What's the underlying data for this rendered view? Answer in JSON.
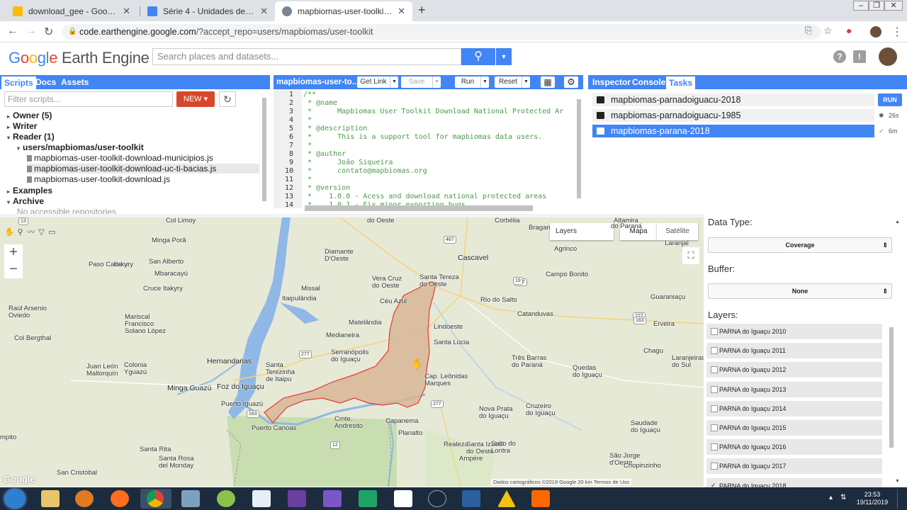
{
  "browser": {
    "tabs": [
      {
        "title": "download_gee - Google Drive",
        "color": "#fbbc05"
      },
      {
        "title": "Série 4 - Unidades de Conservaç",
        "color": "#4285f4"
      },
      {
        "title": "mapbiomas-user-toolkit-downlo",
        "color": "#7a8594"
      }
    ],
    "url_host": "code.earthengine.google.com",
    "url_path": "/?accept_repo=users/mapbiomas/user-toolkit"
  },
  "header": {
    "logo_google": [
      "G",
      "o",
      "o",
      "g",
      "l",
      "e"
    ],
    "logo_rest": "Earth Engine",
    "search_placeholder": "Search places and datasets..."
  },
  "left_panel": {
    "tabs": [
      "Scripts",
      "Docs",
      "Assets"
    ],
    "filter_placeholder": "Filter scripts...",
    "new_label": "NEW",
    "tree": [
      {
        "label": "Owner  (5)",
        "arrow": "▸",
        "bold": true,
        "indent": 0
      },
      {
        "label": "Writer",
        "arrow": "▸",
        "bold": true,
        "indent": 0
      },
      {
        "label": "Reader  (1)",
        "arrow": "▾",
        "bold": true,
        "indent": 0
      },
      {
        "label": "users/mapbiomas/user-toolkit",
        "arrow": "▾",
        "bold": true,
        "indent": 1
      },
      {
        "label": "mapbiomas-user-toolkit-download-municipios.js",
        "file": true,
        "indent": 2
      },
      {
        "label": "mapbiomas-user-toolkit-download-uc-ti-bacias.js",
        "file": true,
        "indent": 2,
        "highlight": true
      },
      {
        "label": "mapbiomas-user-toolkit-download.js",
        "file": true,
        "indent": 2
      },
      {
        "label": "Examples",
        "arrow": "▸",
        "bold": true,
        "indent": 0
      },
      {
        "label": "Archive",
        "arrow": "▾",
        "bold": true,
        "indent": 0
      },
      {
        "label": "No accessible repositories",
        "indent": 1,
        "muted": true
      }
    ]
  },
  "code_panel": {
    "title": "mapbiomas-user-to...",
    "buttons": [
      "Get Link",
      "Save",
      "Run",
      "Reset"
    ],
    "lines": [
      {
        "n": "1",
        "t": "/**"
      },
      {
        "n": "2",
        "t": " * @name"
      },
      {
        "n": "3",
        "t": " *      Mapbiomas User Toolkit Download National Protected Ar"
      },
      {
        "n": "4",
        "t": " *"
      },
      {
        "n": "5",
        "t": " * @description"
      },
      {
        "n": "6",
        "t": " *      This is a support tool for mapbiomas data users."
      },
      {
        "n": "7",
        "t": " *"
      },
      {
        "n": "8",
        "t": " * @author"
      },
      {
        "n": "9",
        "t": " *      João Siqueira"
      },
      {
        "n": "10",
        "t": " *      contato@mapbiomas.org"
      },
      {
        "n": "11",
        "t": " *"
      },
      {
        "n": "12",
        "t": " * @version"
      },
      {
        "n": "13",
        "t": " *    1.0.0 - Acess and download national protected areas"
      },
      {
        "n": "14",
        "t": " *    1.0.1 - Fix minor exporting bugs"
      }
    ]
  },
  "task_panel": {
    "tabs": [
      "Inspector",
      "Console",
      "Tasks"
    ],
    "tasks": [
      {
        "name": "mapbiomas-parnadoiguacu-2018",
        "status": "RUN"
      },
      {
        "name": "mapbiomas-parnadoiguacu-1985",
        "status": "26s"
      },
      {
        "name": "mapbiomas-parana-2018",
        "status": "6m"
      }
    ]
  },
  "map": {
    "layers_label": "Layers",
    "map_types": [
      "Mapa",
      "Satélite"
    ],
    "places": [
      {
        "t": "Col Limoy",
        "c": "mid"
      },
      {
        "t": "do Oeste",
        "c": "mid"
      },
      {
        "t": "Corbélia",
        "c": "mid"
      },
      {
        "t": "Bragan",
        "c": "mid"
      },
      {
        "t": "Altamira",
        "c": "mid"
      },
      {
        "t": "do Paraná",
        "c": "mid"
      },
      {
        "t": "Minga Porã",
        "c": "mid"
      },
      {
        "t": "Diamante\nD'Oeste",
        "c": "mid"
      },
      {
        "t": "Cascavel",
        "c": "big"
      },
      {
        "t": "Agrinco",
        "c": "mid"
      },
      {
        "t": "Laranjal",
        "c": "mid"
      },
      {
        "t": "Paso Cadena",
        "c": "mid"
      },
      {
        "t": "Itakyry",
        "c": "mid"
      },
      {
        "t": "San Alberto",
        "c": "mid"
      },
      {
        "t": "Mbaracayú",
        "c": "mid"
      },
      {
        "t": "Vera Cruz\ndo Oeste",
        "c": "mid"
      },
      {
        "t": "Santa Tereza\ndo Oeste",
        "c": "mid"
      },
      {
        "t": "Campo Bonito",
        "c": "mid"
      },
      {
        "t": "Cruce Itakyry",
        "c": "mid"
      },
      {
        "t": "Missal",
        "c": "mid"
      },
      {
        "t": "Itaipulândia",
        "c": "mid"
      },
      {
        "t": "Céu Azul",
        "c": "mid"
      },
      {
        "t": "Rio do Salto",
        "c": "mid"
      },
      {
        "t": "Guaraniaçu",
        "c": "mid"
      },
      {
        "t": "Raúl Arsenio\nOviedo",
        "c": "mid"
      },
      {
        "t": "Mariscal\nFrancisco\nSolano López",
        "c": "mid"
      },
      {
        "t": "Matelândia",
        "c": "mid"
      },
      {
        "t": "Lindoeste",
        "c": "mid"
      },
      {
        "t": "Catanduvas",
        "c": "mid"
      },
      {
        "t": "Erveira",
        "c": "mid"
      },
      {
        "t": "Medianeira",
        "c": "mid"
      },
      {
        "t": "Col Bergthal",
        "c": "mid"
      },
      {
        "t": "Serranópolis\ndo Iguaçu",
        "c": "mid"
      },
      {
        "t": "Santa Lúcia",
        "c": "mid"
      },
      {
        "t": "Três Barras\ndo Paraná",
        "c": "mid"
      },
      {
        "t": "Chagu",
        "c": "mid"
      },
      {
        "t": "Hernandarias",
        "c": "big"
      },
      {
        "t": "Juan León\nMallorquín",
        "c": "mid"
      },
      {
        "t": "Colonia\nYguazú",
        "c": "mid"
      },
      {
        "t": "Santa\nTerezinha\nde Itaipu",
        "c": "mid"
      },
      {
        "t": "Cap. Leônidas\nMarques",
        "c": "mid"
      },
      {
        "t": "Quedas\ndo Iguaçu",
        "c": "mid"
      },
      {
        "t": "Laranjeiras\ndo Sul",
        "c": "mid"
      },
      {
        "t": "Minga Guazú",
        "c": "big"
      },
      {
        "t": "Foz do Iguaçu",
        "c": "big"
      },
      {
        "t": "Puerto Iguazú",
        "c": "mid"
      },
      {
        "t": "Capanema",
        "c": "mid"
      },
      {
        "t": "Nova Prata\ndo Iguaçu",
        "c": "mid"
      },
      {
        "t": "Cruzeiro\ndo Iguaçu",
        "c": "mid"
      },
      {
        "t": "Puerto Canoas",
        "c": "mid"
      },
      {
        "t": "Cmte.\nAndresito",
        "c": "mid"
      },
      {
        "t": "Planalto",
        "c": "mid"
      },
      {
        "t": "Saudade\ndo Iguaçu",
        "c": "mid"
      },
      {
        "t": "Santa Rita",
        "c": "mid"
      },
      {
        "t": "Santa Rosa\ndel Monday",
        "c": "mid"
      },
      {
        "t": "Realeza",
        "c": "mid"
      },
      {
        "t": "Santa Izabel\ndo Oeste",
        "c": "mid"
      },
      {
        "t": "Salto do\nLontra",
        "c": "mid"
      },
      {
        "t": "São Jorge\nd'Oeste",
        "c": "mid"
      },
      {
        "t": "Chopinzinho",
        "c": "mid"
      },
      {
        "t": "San Cristóbal",
        "c": "mid"
      },
      {
        "t": "Ampére",
        "c": "mid"
      },
      {
        "t": "mpito",
        "c": "mid"
      }
    ],
    "roads": [
      "13",
      "467",
      "277",
      "277",
      "277",
      "277",
      "163",
      "12",
      "163",
      "19"
    ],
    "attribution": "Dados cartográficos ©2019 Google    20 km          Termos de Uso",
    "watermark": "Google"
  },
  "side_panel": {
    "data_type_label": "Data Type:",
    "data_type_value": "Coverage",
    "buffer_label": "Buffer:",
    "buffer_value": "None",
    "layers_label": "Layers:",
    "layers": [
      {
        "label": "PARNA do Iguaçu 2010",
        "checked": false
      },
      {
        "label": "PARNA do Iguaçu 2011",
        "checked": false
      },
      {
        "label": "PARNA do Iguaçu 2012",
        "checked": false
      },
      {
        "label": "PARNA do Iguaçu 2013",
        "checked": false
      },
      {
        "label": "PARNA do Iguaçu 2014",
        "checked": false
      },
      {
        "label": "PARNA do Iguaçu 2015",
        "checked": false
      },
      {
        "label": "PARNA do Iguaçu 2016",
        "checked": false
      },
      {
        "label": "PARNA do Iguaçu 2017",
        "checked": false
      },
      {
        "label": "PARNA do Iguaçu 2018",
        "checked": true
      }
    ]
  },
  "taskbar": {
    "time": "23:53",
    "date": "19/11/2019"
  },
  "colors": {
    "accent": "#4285f4",
    "new_button": "#d9472b",
    "polygon_fill": "#d8b596",
    "polygon_stroke": "#e53935",
    "water": "#8fb8e6"
  }
}
